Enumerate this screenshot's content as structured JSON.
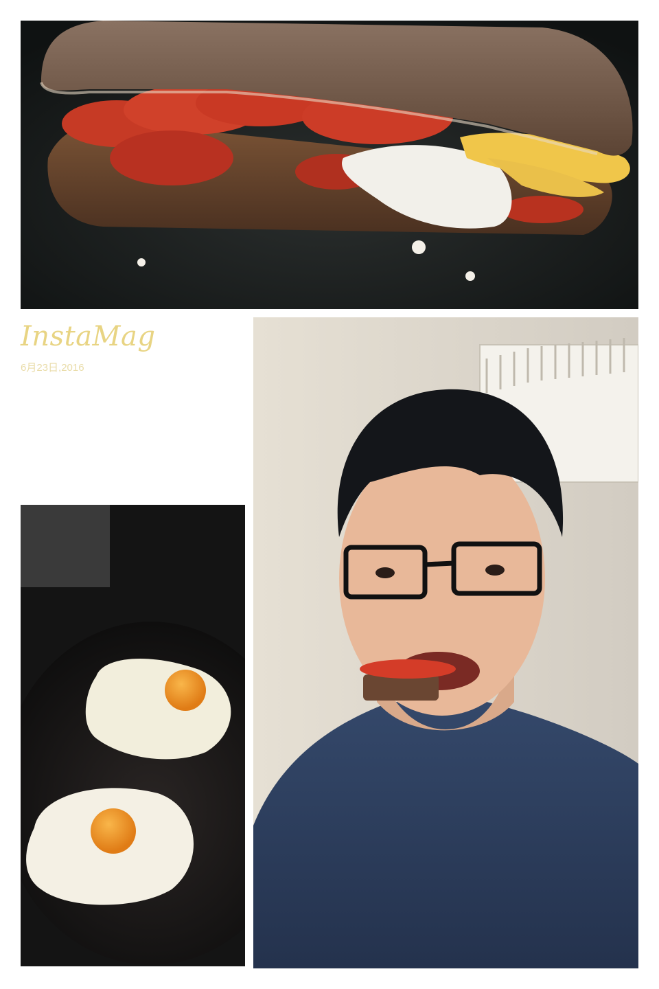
{
  "watermark": {
    "brand": "InstaMag",
    "date": "6月23日,2016"
  },
  "photos": [
    {
      "id": "sandwich",
      "subject": "open toasted sandwich with tomato slices and fried egg on a griddle"
    },
    {
      "id": "selfie",
      "subject": "man with glasses biting a sandwich"
    },
    {
      "id": "eggs",
      "subject": "two fried eggs in a black pan"
    }
  ],
  "colors": {
    "background": "#ffffff",
    "brand_text": "#e8d483",
    "date_text": "#e9dca8"
  }
}
